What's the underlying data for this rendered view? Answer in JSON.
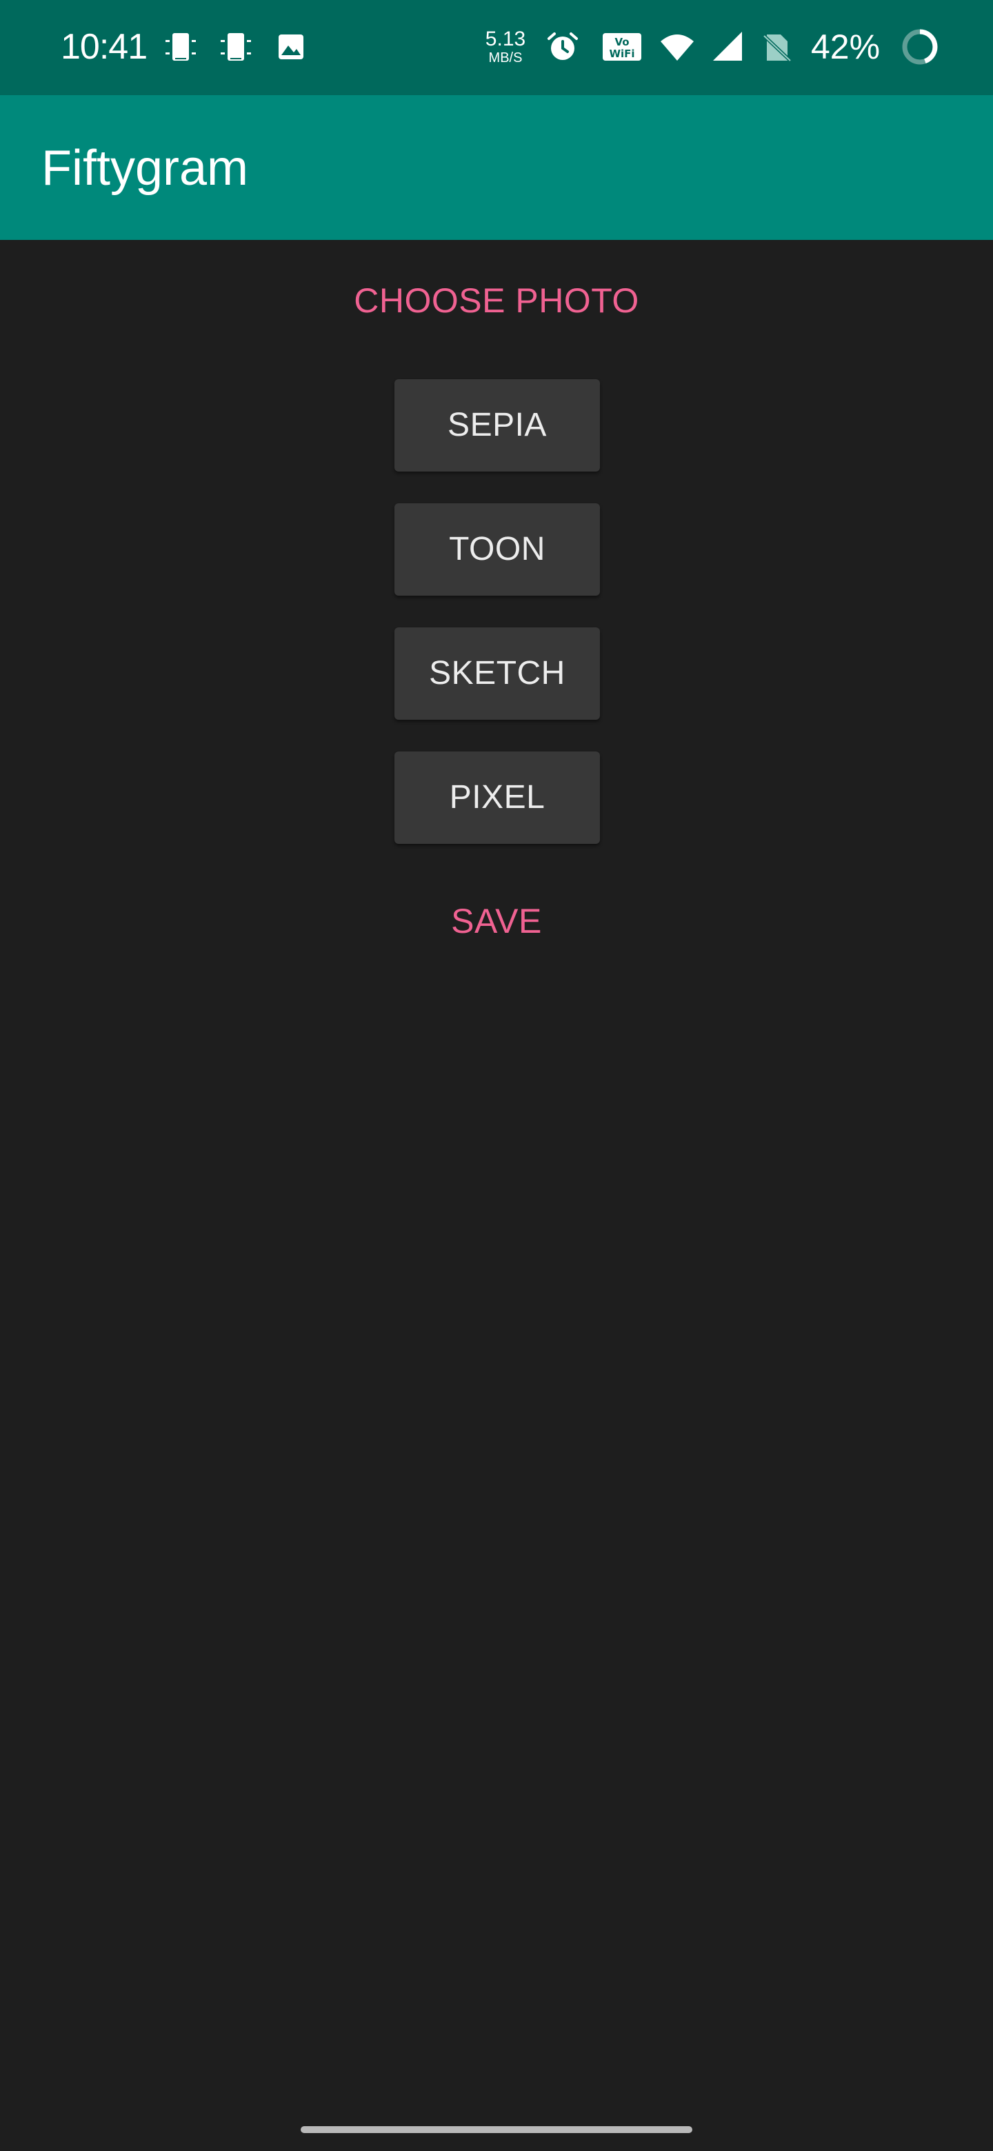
{
  "status_bar": {
    "time": "10:41",
    "net_speed_value": "5.13",
    "net_speed_unit": "MB/S",
    "battery_percent": "42%",
    "icons": [
      "vibrate-phone-icon",
      "vibrate-phone-icon",
      "image-icon",
      "alarm-icon",
      "vowifi-icon",
      "wifi-icon",
      "signal-icon",
      "no-sim-icon",
      "battery-ring-icon"
    ]
  },
  "app_bar": {
    "title": "Fiftygram"
  },
  "actions": {
    "choose_photo": "CHOOSE PHOTO",
    "save": "SAVE"
  },
  "filters": {
    "sepia": "SEPIA",
    "toon": "TOON",
    "sketch": "SKETCH",
    "pixel": "PIXEL"
  },
  "colors": {
    "status_bar": "#00695c",
    "app_bar": "#00897b",
    "background": "#1e1e1e",
    "accent": "#f06292",
    "button": "#383838"
  }
}
